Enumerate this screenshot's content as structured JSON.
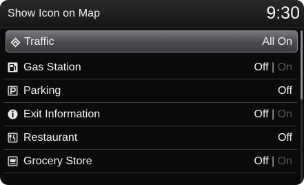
{
  "header": {
    "title": "Show Icon on Map",
    "clock": "9:30"
  },
  "items": [
    {
      "label": "Traffic",
      "icon": "traffic-icon",
      "value": "All On",
      "selected": true
    },
    {
      "label": "Gas Station",
      "icon": "gas-station-icon",
      "value_on": "Off",
      "separator": "|",
      "value_off": "On"
    },
    {
      "label": "Parking",
      "icon": "parking-icon",
      "value": "Off"
    },
    {
      "label": "Exit Information",
      "icon": "exit-information-icon",
      "value_on": "Off",
      "separator": "|",
      "value_off": "On"
    },
    {
      "label": "Restaurant",
      "icon": "restaurant-icon",
      "value": "Off"
    },
    {
      "label": "Grocery Store",
      "icon": "grocery-store-icon",
      "value_on": "Off",
      "separator": "|",
      "value_off": "On"
    }
  ],
  "colors": {
    "background": "#0b0b0c",
    "header": "#2a2a2c",
    "text": "#f2f2f2",
    "dim_text": "#58585c",
    "selected_highlight": "#5a5a5f"
  }
}
